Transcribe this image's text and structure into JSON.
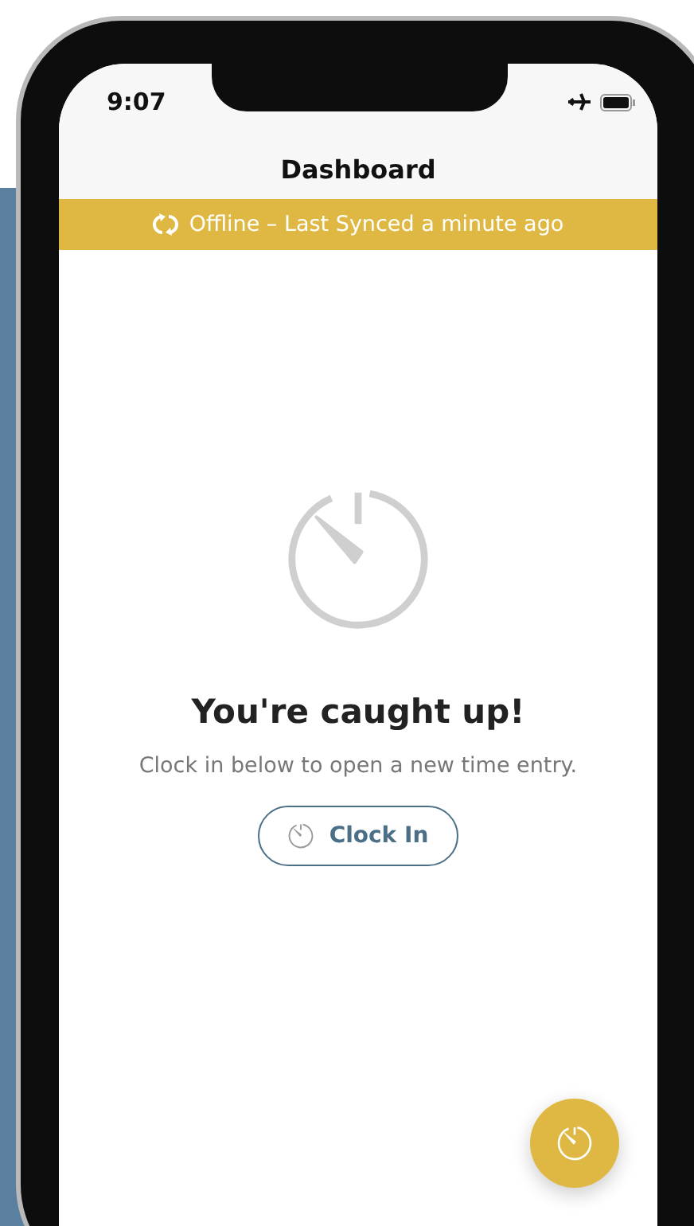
{
  "status_bar": {
    "time": "9:07"
  },
  "header": {
    "title": "Dashboard"
  },
  "banner": {
    "text": "Offline – Last Synced a minute ago"
  },
  "empty_state": {
    "title": "You're caught up!",
    "message": "Clock in below to open a new time entry.",
    "button": "Clock In"
  }
}
